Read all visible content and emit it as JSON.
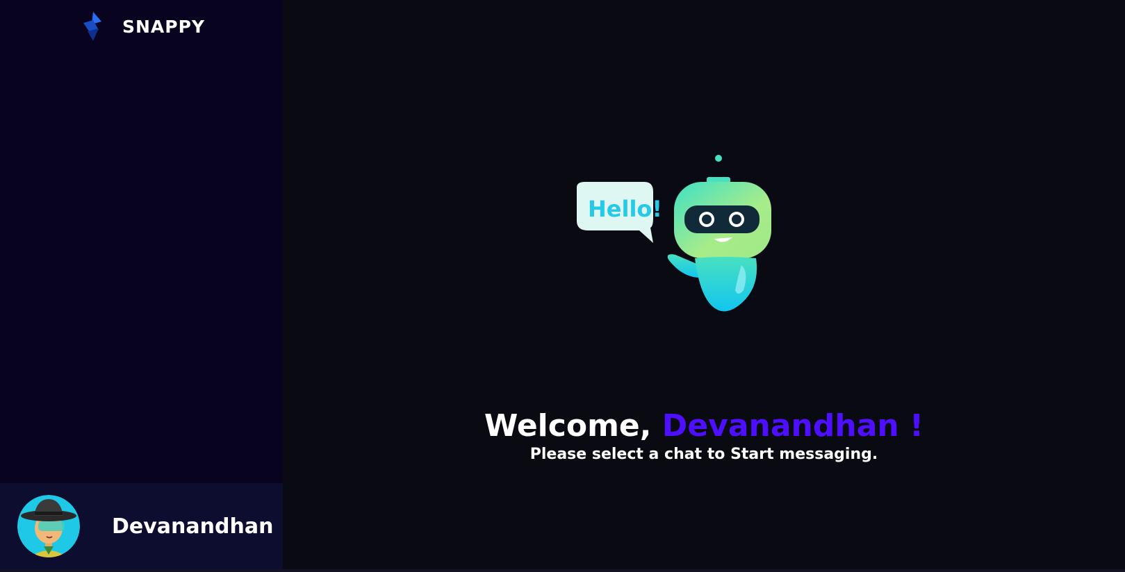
{
  "brand": {
    "name": "SNAPPY",
    "logo": "snappy-logo-icon"
  },
  "current_user": {
    "name": "Devanandhan",
    "avatar": "explorer-avatar"
  },
  "welcome": {
    "prefix": "Welcome, ",
    "name": "Devanandhan !",
    "subtitle": "Please select a chat to Start messaging.",
    "bubble_text": "Hello!",
    "robot": "robot-hello-illustration"
  },
  "colors": {
    "accent": "#4e0eff",
    "sidebar_bg": "#080420",
    "user_panel_bg": "#0d0d30",
    "main_bg": "#0a0a13"
  }
}
